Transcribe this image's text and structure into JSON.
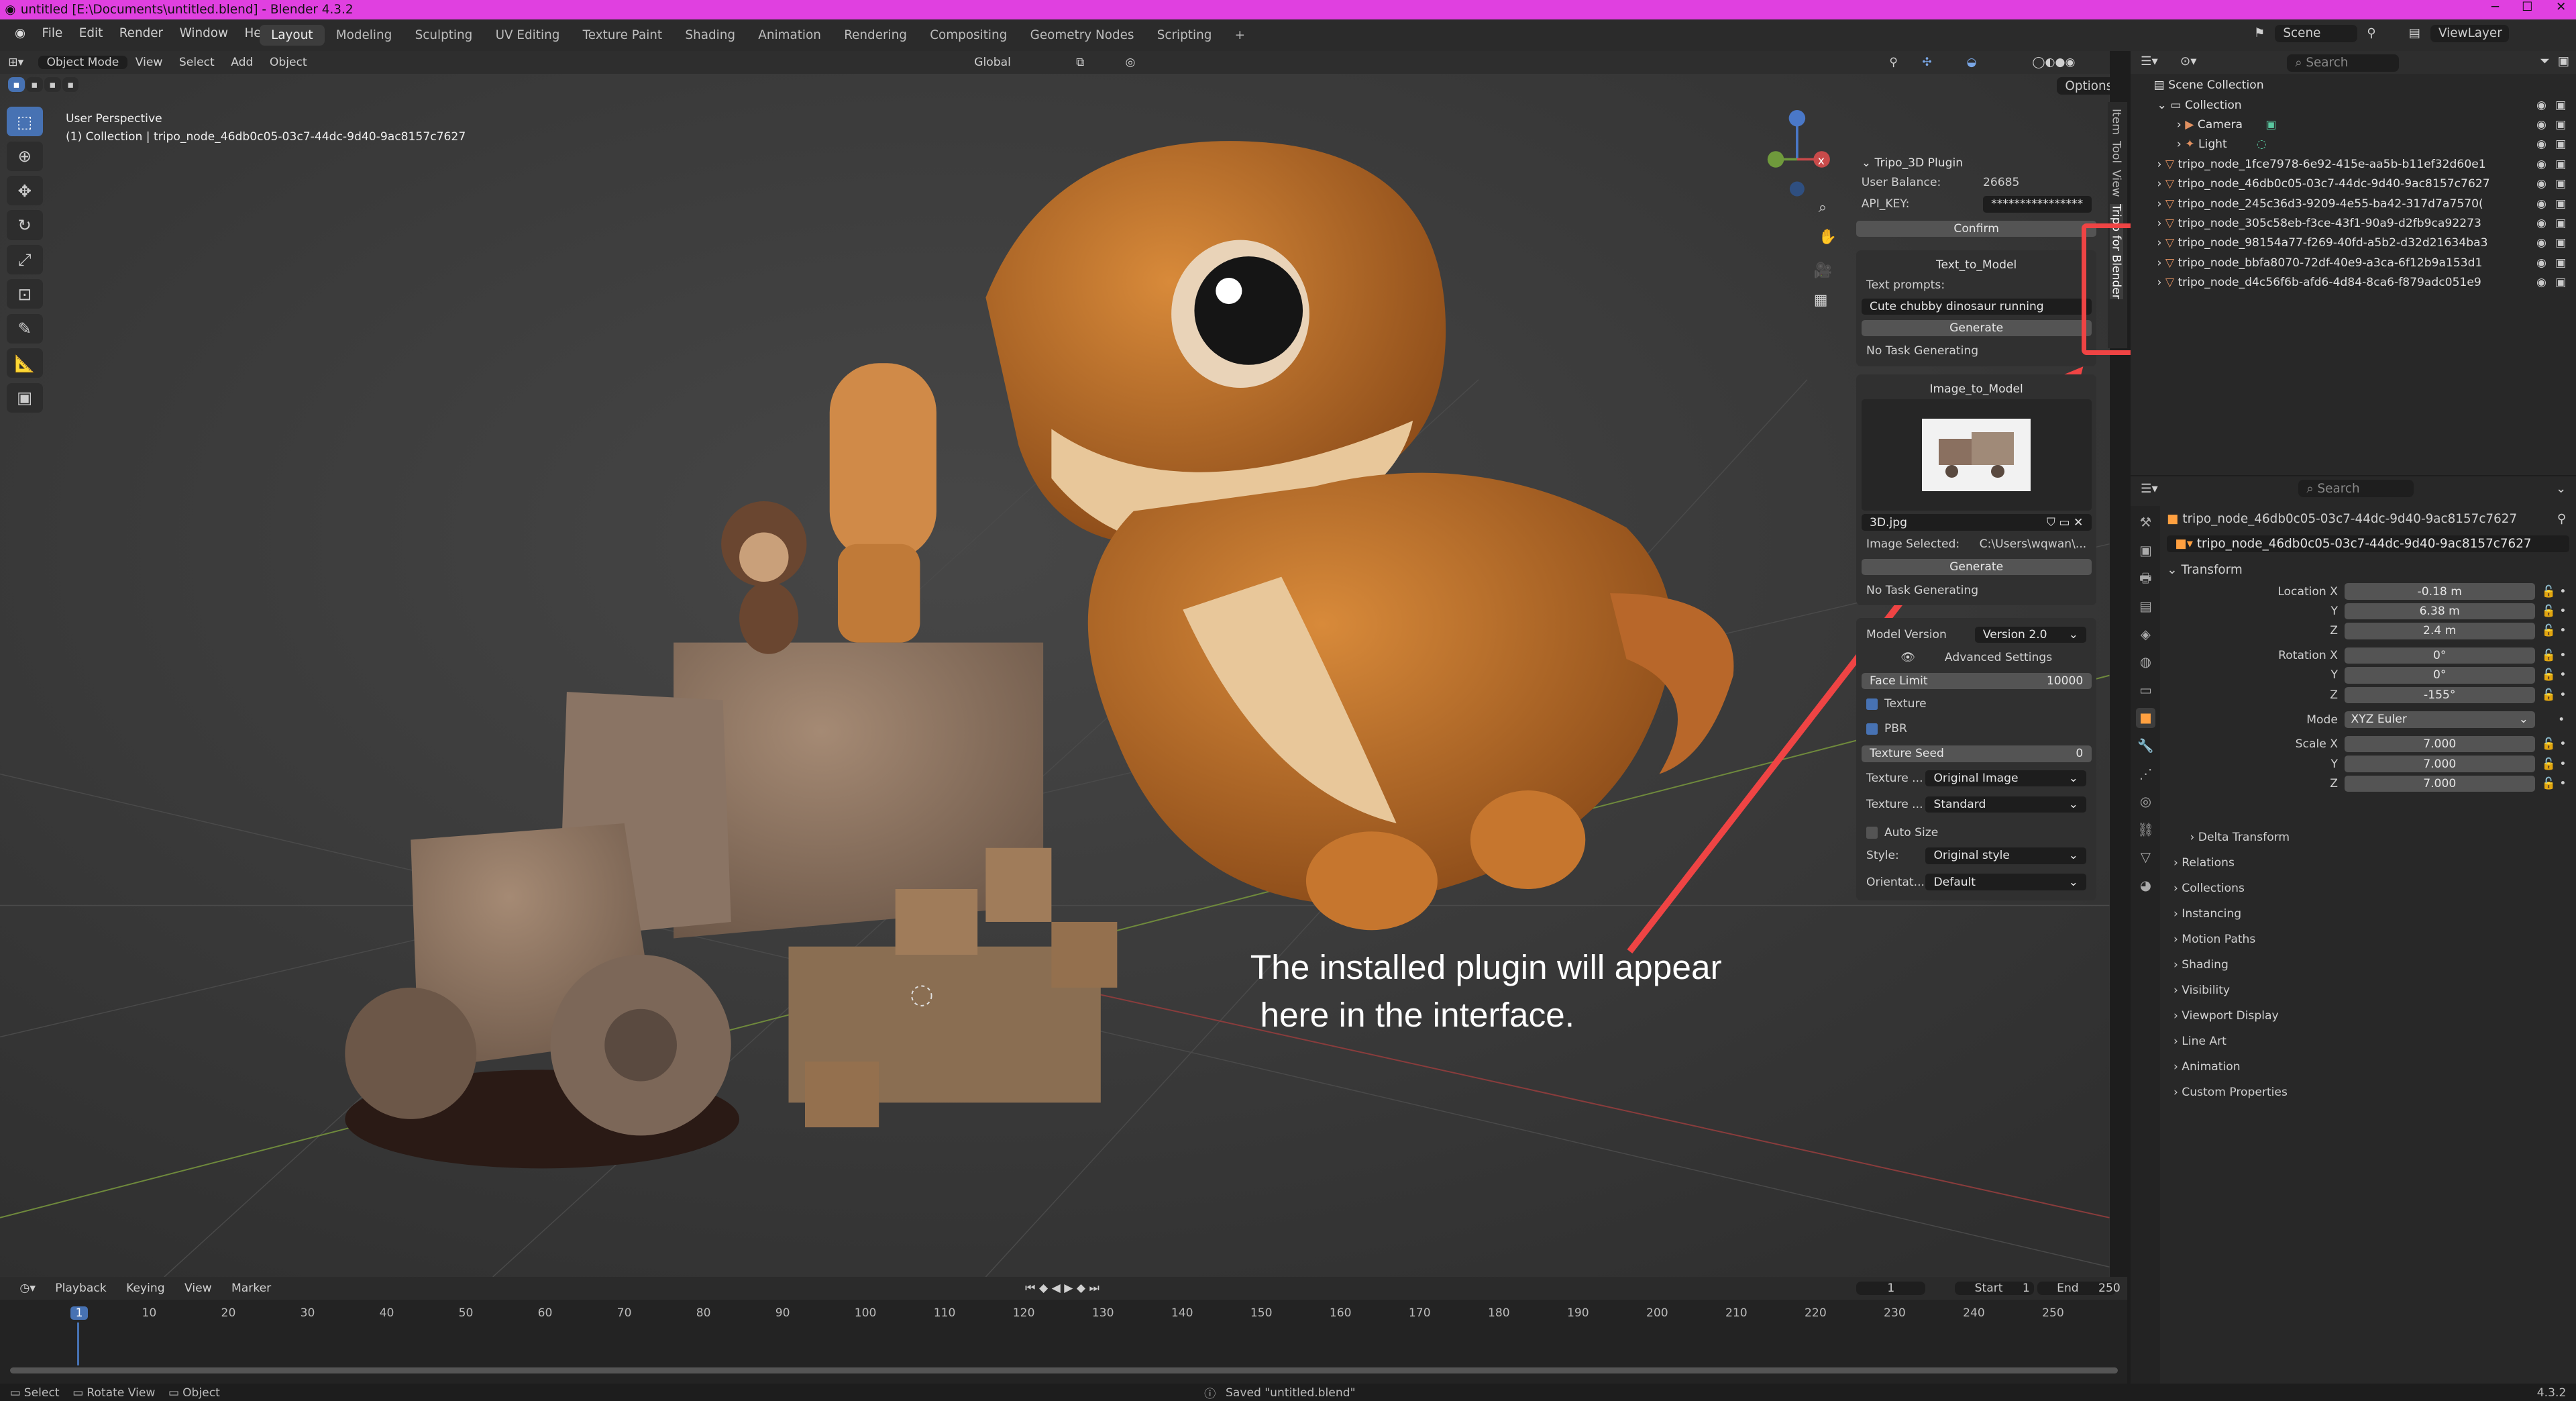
{
  "window": {
    "title": "untitled [E:\\Documents\\untitled.blend] - Blender 4.3.2"
  },
  "menu": [
    "File",
    "Edit",
    "Render",
    "Window",
    "Help"
  ],
  "workspaces": [
    "Layout",
    "Modeling",
    "Sculpting",
    "UV Editing",
    "Texture Paint",
    "Shading",
    "Animation",
    "Rendering",
    "Compositing",
    "Geometry Nodes",
    "Scripting"
  ],
  "scene": {
    "scene_label": "Scene",
    "view_layer": "ViewLayer"
  },
  "viewport": {
    "mode": "Object Mode",
    "menus": [
      "View",
      "Select",
      "Add",
      "Object"
    ],
    "orientation": "Global",
    "options_label": "Options",
    "perspective": "User Perspective",
    "active_info": "(1) Collection | tripo_node_46db0c05-03c7-44dc-9d40-9ac8157c7627",
    "annotation_line1": "The installed plugin will appear",
    "annotation_line2": "here in the interface."
  },
  "plugin": {
    "title": "Tripo_3D Plugin",
    "balance_label": "User Balance:",
    "balance_value": "26685",
    "api_label": "API_KEY:",
    "api_value": "****************",
    "confirm": "Confirm",
    "t2m_title": "Text_to_Model",
    "prompt_label": "Text prompts:",
    "prompt_value": "Cute chubby dinosaur running",
    "generate": "Generate",
    "status": "No Task Generating",
    "i2m_title": "Image_to_Model",
    "image_file": "3D.jpg",
    "image_selected_label": "Image Selected:",
    "image_selected_value": "C:\\Users\\wqwan\\...",
    "model_version_label": "Model Version",
    "model_version_value": "Version 2.0",
    "advanced": "Advanced Settings",
    "face_limit_label": "Face Limit",
    "face_limit_value": "10000",
    "texture": "Texture",
    "pbr": "PBR",
    "texture_seed_label": "Texture Seed",
    "texture_seed_value": "0",
    "tex_align_label": "Texture ...",
    "tex_align_value": "Original Image",
    "tex_quality_label": "Texture ...",
    "tex_quality_value": "Standard",
    "auto_size": "Auto Size",
    "style_label": "Style:",
    "style_value": "Original style",
    "orient_label": "Orientat...",
    "orient_value": "Default"
  },
  "sidebar_tabs": [
    "Item",
    "Tool",
    "View",
    "Tripo for Blender"
  ],
  "timeline": {
    "menus": [
      "Playback",
      "Keying",
      "View",
      "Marker"
    ],
    "current_frame": "1",
    "start_label": "Start",
    "start": "1",
    "end_label": "End",
    "end": "250",
    "ticks": [
      "1",
      "10",
      "20",
      "30",
      "40",
      "50",
      "60",
      "70",
      "80",
      "90",
      "100",
      "110",
      "120",
      "130",
      "140",
      "150",
      "160",
      "170",
      "180",
      "190",
      "200",
      "210",
      "220",
      "230",
      "240",
      "250"
    ]
  },
  "status": {
    "select": "Select",
    "rotate": "Rotate View",
    "object": "Object",
    "message": "Saved \"untitled.blend\"",
    "version": "4.3.2"
  },
  "outliner": {
    "search_placeholder": "Search",
    "scene_collection": "Scene Collection",
    "collection": "Collection",
    "camera": "Camera",
    "light": "Light",
    "nodes": [
      "tripo_node_1fce7978-6e92-415e-aa5b-b11ef32d60e1",
      "tripo_node_46db0c05-03c7-44dc-9d40-9ac8157c7627",
      "tripo_node_245c36d3-9209-4e55-ba42-317d7a7570(",
      "tripo_node_305c58eb-f3ce-43f1-90a9-d2fb9ca92273",
      "tripo_node_98154a77-f269-40fd-a5b2-d32d21634ba3",
      "tripo_node_bbfa8070-72df-40e9-a3ca-6f12b9a153d1",
      "tripo_node_d4c56f6b-afd6-4d84-8ca6-f879adc051e9"
    ]
  },
  "properties": {
    "search_placeholder": "Search",
    "object_name": "tripo_node_46db0c05-03c7-44dc-9d40-9ac8157c7627",
    "transform": "Transform",
    "location_x_label": "Location X",
    "location_x": "-0.18 m",
    "location_y": "6.38 m",
    "location_z": "2.4 m",
    "rotation_x_label": "Rotation X",
    "rotation_x": "0°",
    "rotation_y": "0°",
    "rotation_z": "-155°",
    "mode_label": "Mode",
    "mode_value": "XYZ Euler",
    "scale_x_label": "Scale X",
    "scale_x": "7.000",
    "scale_y": "7.000",
    "scale_z": "7.000",
    "y_label": "Y",
    "z_label": "Z",
    "delta": "Delta Transform",
    "sections": [
      "Relations",
      "Collections",
      "Instancing",
      "Motion Paths",
      "Shading",
      "Visibility",
      "Viewport Display",
      "Line Art",
      "Animation",
      "Custom Properties"
    ]
  },
  "colors": {
    "accent": "#4772b3",
    "annotation_red": "#ef4444",
    "title_bar": "#e040e0"
  }
}
